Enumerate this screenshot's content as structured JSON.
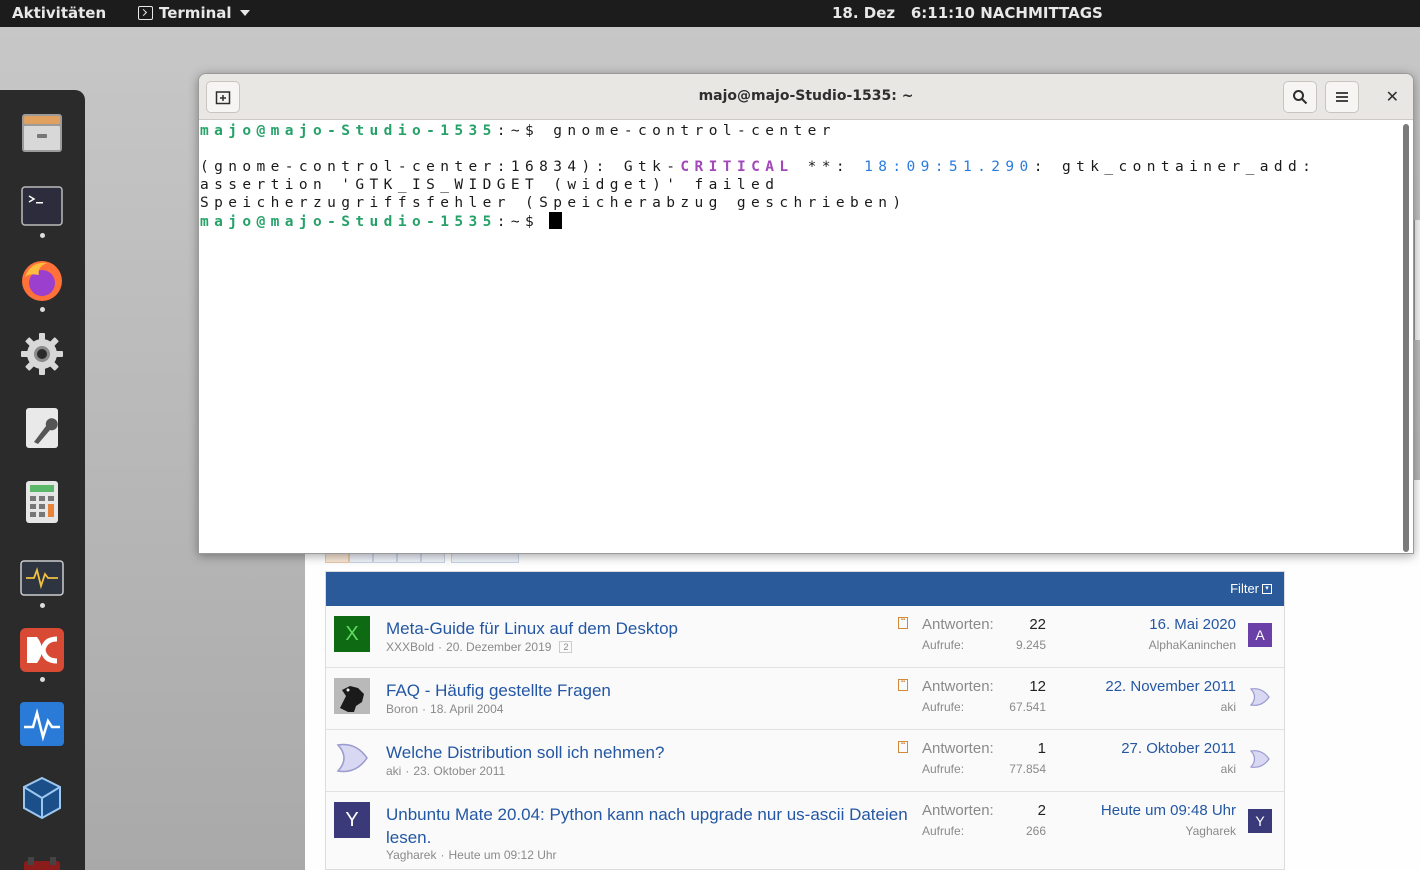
{
  "topbar": {
    "activities": "Aktivitäten",
    "app_name": "Terminal",
    "clock": "18. Dez   6:11:10 NACHMITTAGS"
  },
  "dock": {
    "items": [
      {
        "name": "files-icon"
      },
      {
        "name": "terminal-icon",
        "running": true
      },
      {
        "name": "firefox-icon",
        "running": true
      },
      {
        "name": "settings-icon"
      },
      {
        "name": "tweaks-icon"
      },
      {
        "name": "calculator-icon"
      },
      {
        "name": "system-monitor-icon",
        "running": true
      },
      {
        "name": "double-commander-icon",
        "running": true
      },
      {
        "name": "stacer-icon"
      },
      {
        "name": "virtualbox-icon"
      },
      {
        "name": "app-icon"
      }
    ]
  },
  "terminal": {
    "title": "majo@majo-Studio-1535: ~",
    "prompt": "majo@majo-Studio-1535",
    "prompt_suffix": ":~$ ",
    "command": "gnome-control-center",
    "line2_pre": "(gnome-control-center:16834): Gtk-",
    "line2_critical": "CRITICAL",
    "line2_mid": " **: ",
    "line2_time": "18:09:51.290",
    "line2_post": ": gtk_container_add:",
    "line3": "assertion 'GTK_IS_WIDGET (widget)' failed",
    "line4": "Speicherzugriffsfehler (Speicherabzug geschrieben)"
  },
  "forum": {
    "filter_label": "Filter",
    "labels": {
      "replies": "Antworten:",
      "views": "Aufrufe:"
    },
    "threads": [
      {
        "title": "Meta-Guide für Linux auf dem Desktop",
        "author": "XXXBold",
        "date": "20. Dezember 2019",
        "pages": "2",
        "avatar_letter": "X",
        "avatar_color": "#1a7a1a",
        "avatar_fg": "#5fdc5f",
        "replies": "22",
        "views": "9.245",
        "last_date": "16. Mai 2020",
        "last_user": "AlphaKaninchen",
        "last_letter": "A",
        "last_color": "#6a3fa8"
      },
      {
        "title": "FAQ - Häufig gestellte Fragen",
        "author": "Boron",
        "date": "18. April 2004",
        "avatar_kind": "raven",
        "replies": "12",
        "views": "67.541",
        "last_date": "22. November 2011",
        "last_user": "aki",
        "last_kind": "aki"
      },
      {
        "title": "Welche Distribution soll ich nehmen?",
        "author": "aki",
        "date": "23. Oktober 2011",
        "avatar_kind": "aki",
        "replies": "1",
        "views": "77.854",
        "last_date": "27. Oktober 2011",
        "last_user": "aki",
        "last_kind": "aki"
      },
      {
        "title": "Unbuntu Mate 20.04: Python kann nach upgrade nur us-ascii Dateien lesen.",
        "author": "Yagharek",
        "date": "Heute um 09:12 Uhr",
        "avatar_letter": "Y",
        "avatar_color": "#3a3a7a",
        "replies": "2",
        "views": "266",
        "last_date": "Heute um 09:48 Uhr",
        "last_user": "Yagharek",
        "last_letter": "Y",
        "last_color": "#3a3a7a"
      }
    ]
  },
  "colors": {
    "prompt_green": "#26a269",
    "critical_magenta": "#a347ba",
    "time_blue": "#2a7bde",
    "forum_header": "#2a5a9a",
    "link_blue": "#2457a3"
  }
}
